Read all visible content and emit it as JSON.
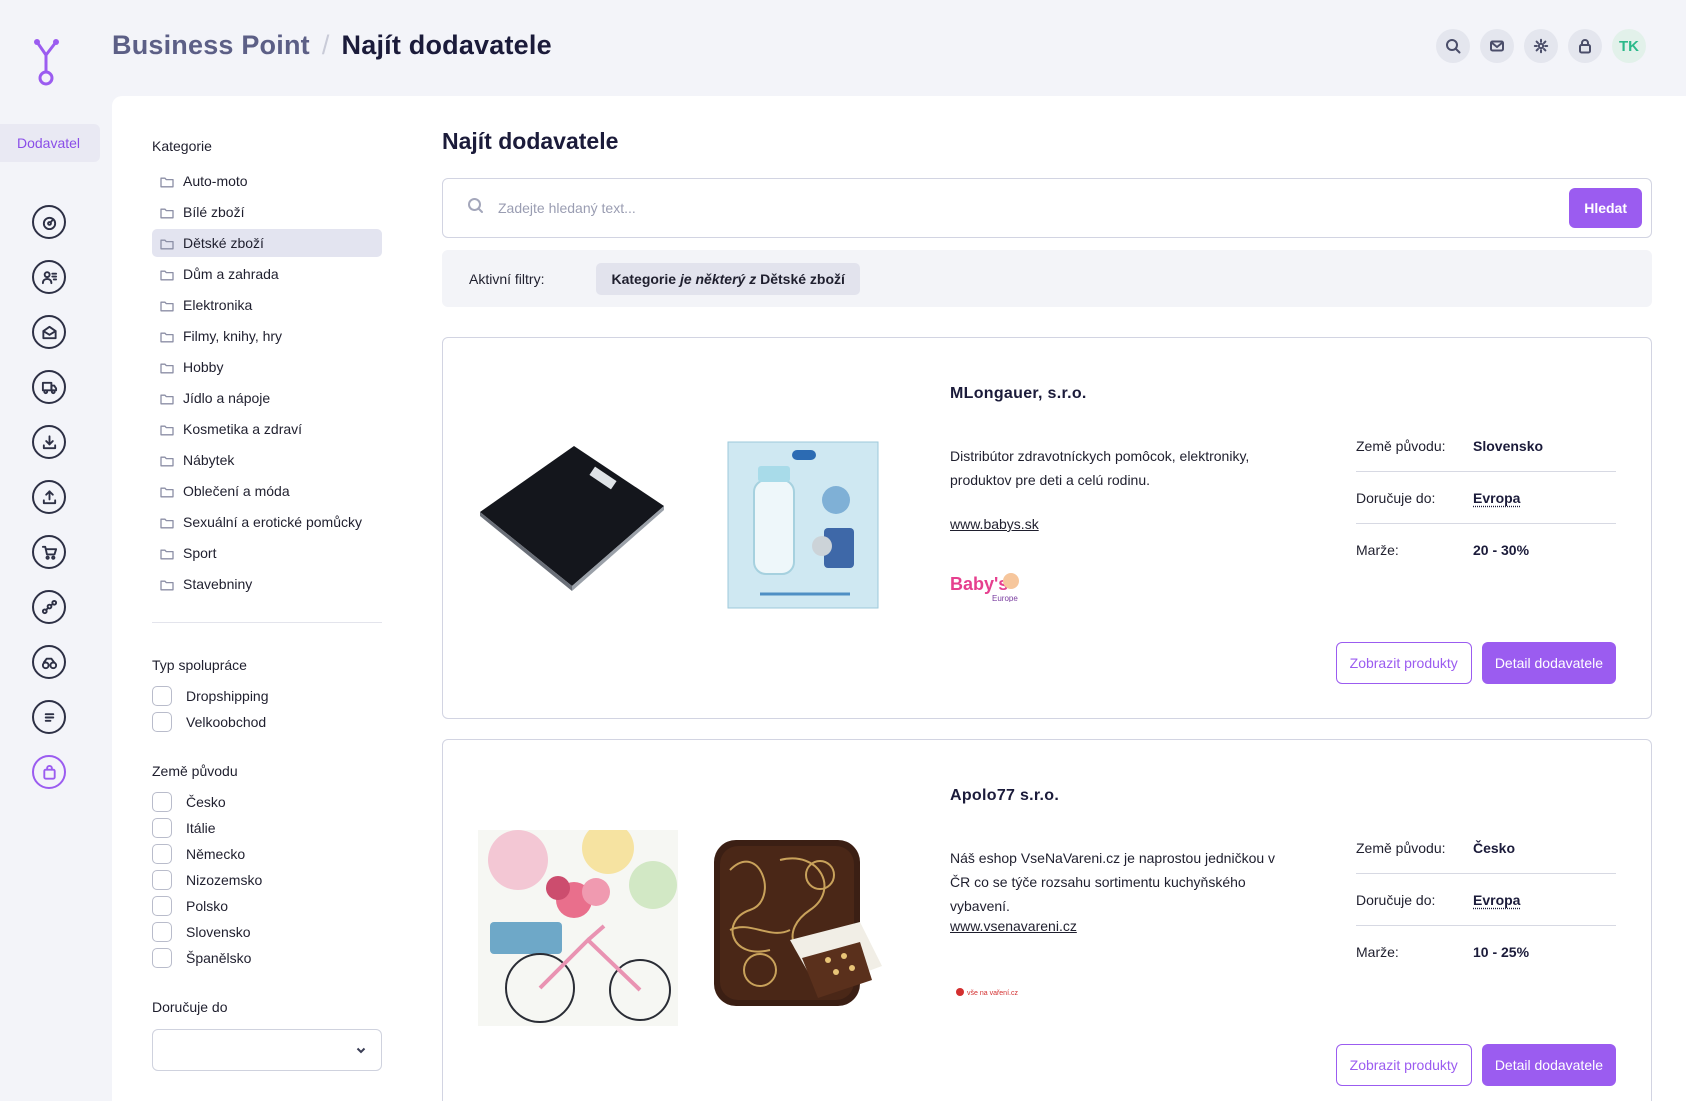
{
  "header": {
    "breadcrumb_root": "Business Point",
    "breadcrumb_separator": "/",
    "breadcrumb_current": "Najít dodavatele",
    "avatar_initials": "TK",
    "actions": [
      "search-icon",
      "mail-icon",
      "gear-icon",
      "lock-icon"
    ]
  },
  "rail": {
    "active_label": "Dodavatel",
    "items": [
      "dashboard-icon",
      "contacts-icon",
      "inbox-icon",
      "truck-icon",
      "download-icon",
      "upload-icon",
      "cart-icon",
      "network-icon",
      "speed-icon",
      "list-icon",
      "bag-icon"
    ]
  },
  "filters": {
    "categories_title": "Kategorie",
    "categories": [
      {
        "label": "Auto-moto",
        "selected": false
      },
      {
        "label": "Bílé zboží",
        "selected": false
      },
      {
        "label": "Dětské zboží",
        "selected": true
      },
      {
        "label": "Dům a zahrada",
        "selected": false
      },
      {
        "label": "Elektronika",
        "selected": false
      },
      {
        "label": "Filmy, knihy, hry",
        "selected": false
      },
      {
        "label": "Hobby",
        "selected": false
      },
      {
        "label": "Jídlo a nápoje",
        "selected": false
      },
      {
        "label": "Kosmetika a zdraví",
        "selected": false
      },
      {
        "label": "Nábytek",
        "selected": false
      },
      {
        "label": "Oblečení a móda",
        "selected": false
      },
      {
        "label": "Sexuální a erotické pomůcky",
        "selected": false
      },
      {
        "label": "Sport",
        "selected": false
      },
      {
        "label": "Stavebniny",
        "selected": false
      }
    ],
    "cooperation_title": "Typ spolupráce",
    "cooperation": [
      {
        "label": "Dropshipping",
        "checked": false
      },
      {
        "label": "Velkoobchod",
        "checked": false
      }
    ],
    "origin_title": "Země původu",
    "origin": [
      {
        "label": "Česko",
        "checked": false
      },
      {
        "label": "Itálie",
        "checked": false
      },
      {
        "label": "Německo",
        "checked": false
      },
      {
        "label": "Nizozemsko",
        "checked": false
      },
      {
        "label": "Polsko",
        "checked": false
      },
      {
        "label": "Slovensko",
        "checked": false
      },
      {
        "label": "Španělsko",
        "checked": false
      }
    ],
    "delivers_title": "Doručuje do",
    "delivers_value": ""
  },
  "main": {
    "title": "Najít dodavatele",
    "search_placeholder": "Zadejte hledaný text...",
    "search_button": "Hledat",
    "active_filters_label": "Aktivní filtry:",
    "chip": {
      "field": "Kategorie",
      "operator": "je některý z",
      "value": "Dětské zboží"
    },
    "labels": {
      "origin": "Země původu:",
      "delivers": "Doručuje do:",
      "margin": "Marže:"
    },
    "buttons": {
      "products": "Zobrazit produkty",
      "detail": "Detail dodavatele"
    },
    "suppliers": [
      {
        "name": "MLongauer, s.r.o.",
        "description": "Distribútor zdravotníckych pomôcok, elektroniky, produktov pre deti a celú rodinu.",
        "website": "www.babys.sk",
        "brand_text": "Baby's",
        "brand_subtext": "Europe",
        "origin": "Slovensko",
        "delivers": "Evropa",
        "margin": "20 - 30%"
      },
      {
        "name": "Apolo77 s.r.o.",
        "description": "Náš eshop VseNaVareni.cz je naprostou jedničkou v ČR co se týče rozsahu sortimentu kuchyňského vybavení.",
        "website": "www.vsenavareni.cz",
        "brand_text": "vše na vaření.cz",
        "origin": "Česko",
        "delivers": "Evropa",
        "margin": "10 - 25%"
      }
    ]
  },
  "colors": {
    "accent": "#9b5cf0",
    "background": "#f3f4f9",
    "avatar": "#2bb98a"
  }
}
